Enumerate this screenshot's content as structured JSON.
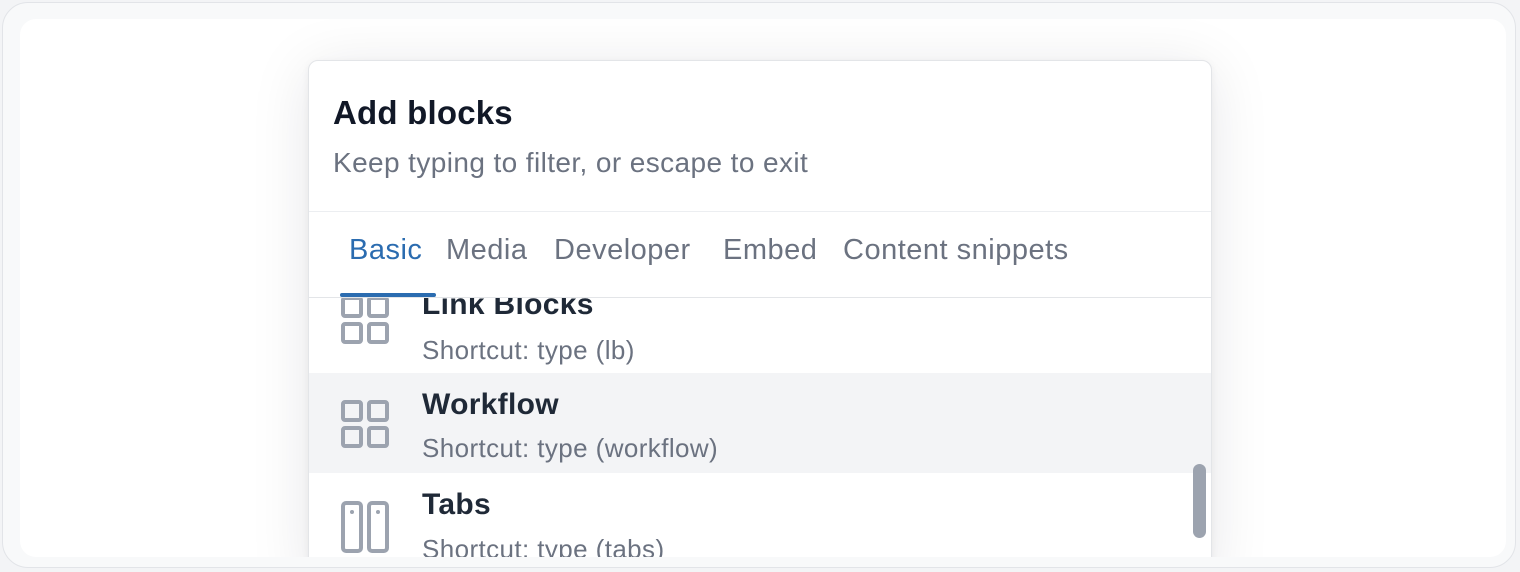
{
  "dialog": {
    "title": "Add blocks",
    "subtitle": "Keep typing to filter, or escape to exit"
  },
  "tabs": [
    {
      "label": "Basic",
      "active": true
    },
    {
      "label": "Media",
      "active": false
    },
    {
      "label": "Developer",
      "active": false
    },
    {
      "label": "Embed",
      "active": false
    },
    {
      "label": "Content snippets",
      "active": false
    }
  ],
  "blocks": [
    {
      "title": "Link Blocks",
      "shortcut": "Shortcut: type (lb)",
      "icon": "grid-icon"
    },
    {
      "title": "Workflow",
      "shortcut": "Shortcut: type (workflow)",
      "icon": "grid-icon",
      "highlighted": true
    },
    {
      "title": "Tabs",
      "shortcut": "Shortcut: type (tabs)",
      "icon": "tabs-columns-icon"
    }
  ],
  "colors": {
    "accent": "#2b6cb0",
    "title_text": "#111827",
    "muted_text": "#6b7280",
    "highlight_bg": "#f3f4f6",
    "icon": "#9ca3af"
  }
}
